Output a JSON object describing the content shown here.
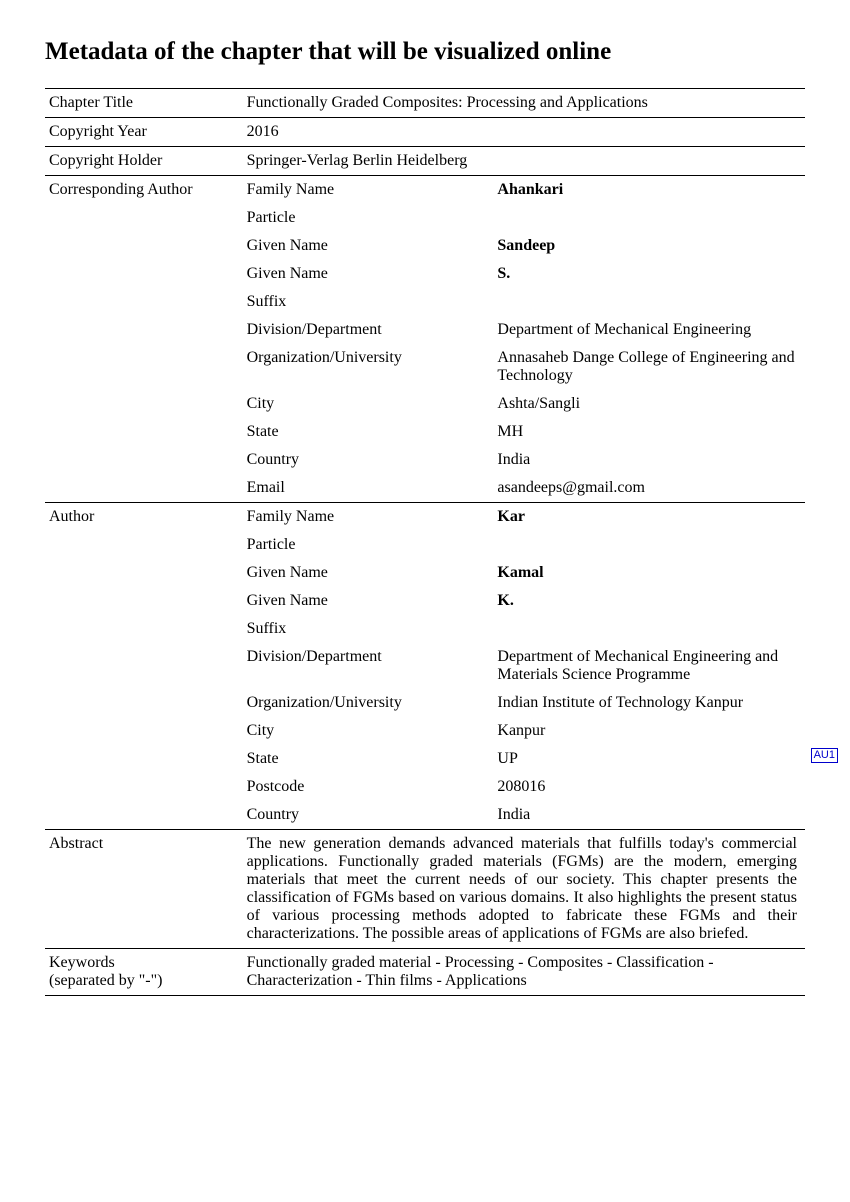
{
  "title": "Metadata of the chapter that will be visualized online",
  "rows": {
    "chapter_title": {
      "label": "Chapter Title",
      "value": "Functionally Graded Composites: Processing and Applications"
    },
    "copyright_year": {
      "label": "Copyright Year",
      "value": "2016"
    },
    "copyright_holder": {
      "label": "Copyright Holder",
      "value": "Springer-Verlag Berlin Heidelberg"
    }
  },
  "corr_author": {
    "label": "Corresponding Author",
    "fields": [
      {
        "k": "Family Name",
        "v": "Ahankari",
        "bold": true
      },
      {
        "k": "Particle",
        "v": ""
      },
      {
        "k": "Given Name",
        "v": "Sandeep",
        "bold": true
      },
      {
        "k": "Given Name",
        "v": "S.",
        "bold": true
      },
      {
        "k": "Suffix",
        "v": ""
      },
      {
        "k": "Division/Department",
        "v": "Department of Mechanical Engineering"
      },
      {
        "k": "Organization/University",
        "v": "Annasaheb Dange College of Engineering and Technology"
      },
      {
        "k": "City",
        "v": "Ashta/Sangli"
      },
      {
        "k": "State",
        "v": "MH"
      },
      {
        "k": "Country",
        "v": "India"
      },
      {
        "k": "Email",
        "v": "asandeeps@gmail.com"
      }
    ]
  },
  "author": {
    "label": "Author",
    "fields": [
      {
        "k": "Family Name",
        "v": "Kar",
        "bold": true
      },
      {
        "k": "Particle",
        "v": ""
      },
      {
        "k": "Given Name",
        "v": "Kamal",
        "bold": true
      },
      {
        "k": "Given Name",
        "v": "K.",
        "bold": true
      },
      {
        "k": "Suffix",
        "v": ""
      },
      {
        "k": "Division/Department",
        "v": "Department of Mechanical Engineering and Materials Science Programme"
      },
      {
        "k": "Organization/University",
        "v": "Indian Institute of Technology Kanpur"
      },
      {
        "k": "City",
        "v": "Kanpur"
      },
      {
        "k": "State",
        "v": "UP"
      },
      {
        "k": "Postcode",
        "v": "208016"
      },
      {
        "k": "Country",
        "v": "India"
      }
    ]
  },
  "abstract": {
    "label": "Abstract",
    "value": "The new generation demands advanced materials that fulfills today's commercial applications. Functionally graded materials (FGMs) are the modern, emerging materials that meet the current needs of our society. This chapter presents the classification of FGMs based on various domains. It also highlights the present status of various processing methods adopted to fabricate these FGMs and their characterizations. The possible areas of applications of FGMs are also briefed."
  },
  "keywords": {
    "label1": "Keywords",
    "label2": "(separated by \"-\")",
    "value": "Functionally graded material - Processing - Composites - Classification - Characterization - Thin films - Applications"
  },
  "annotation": "AU1"
}
